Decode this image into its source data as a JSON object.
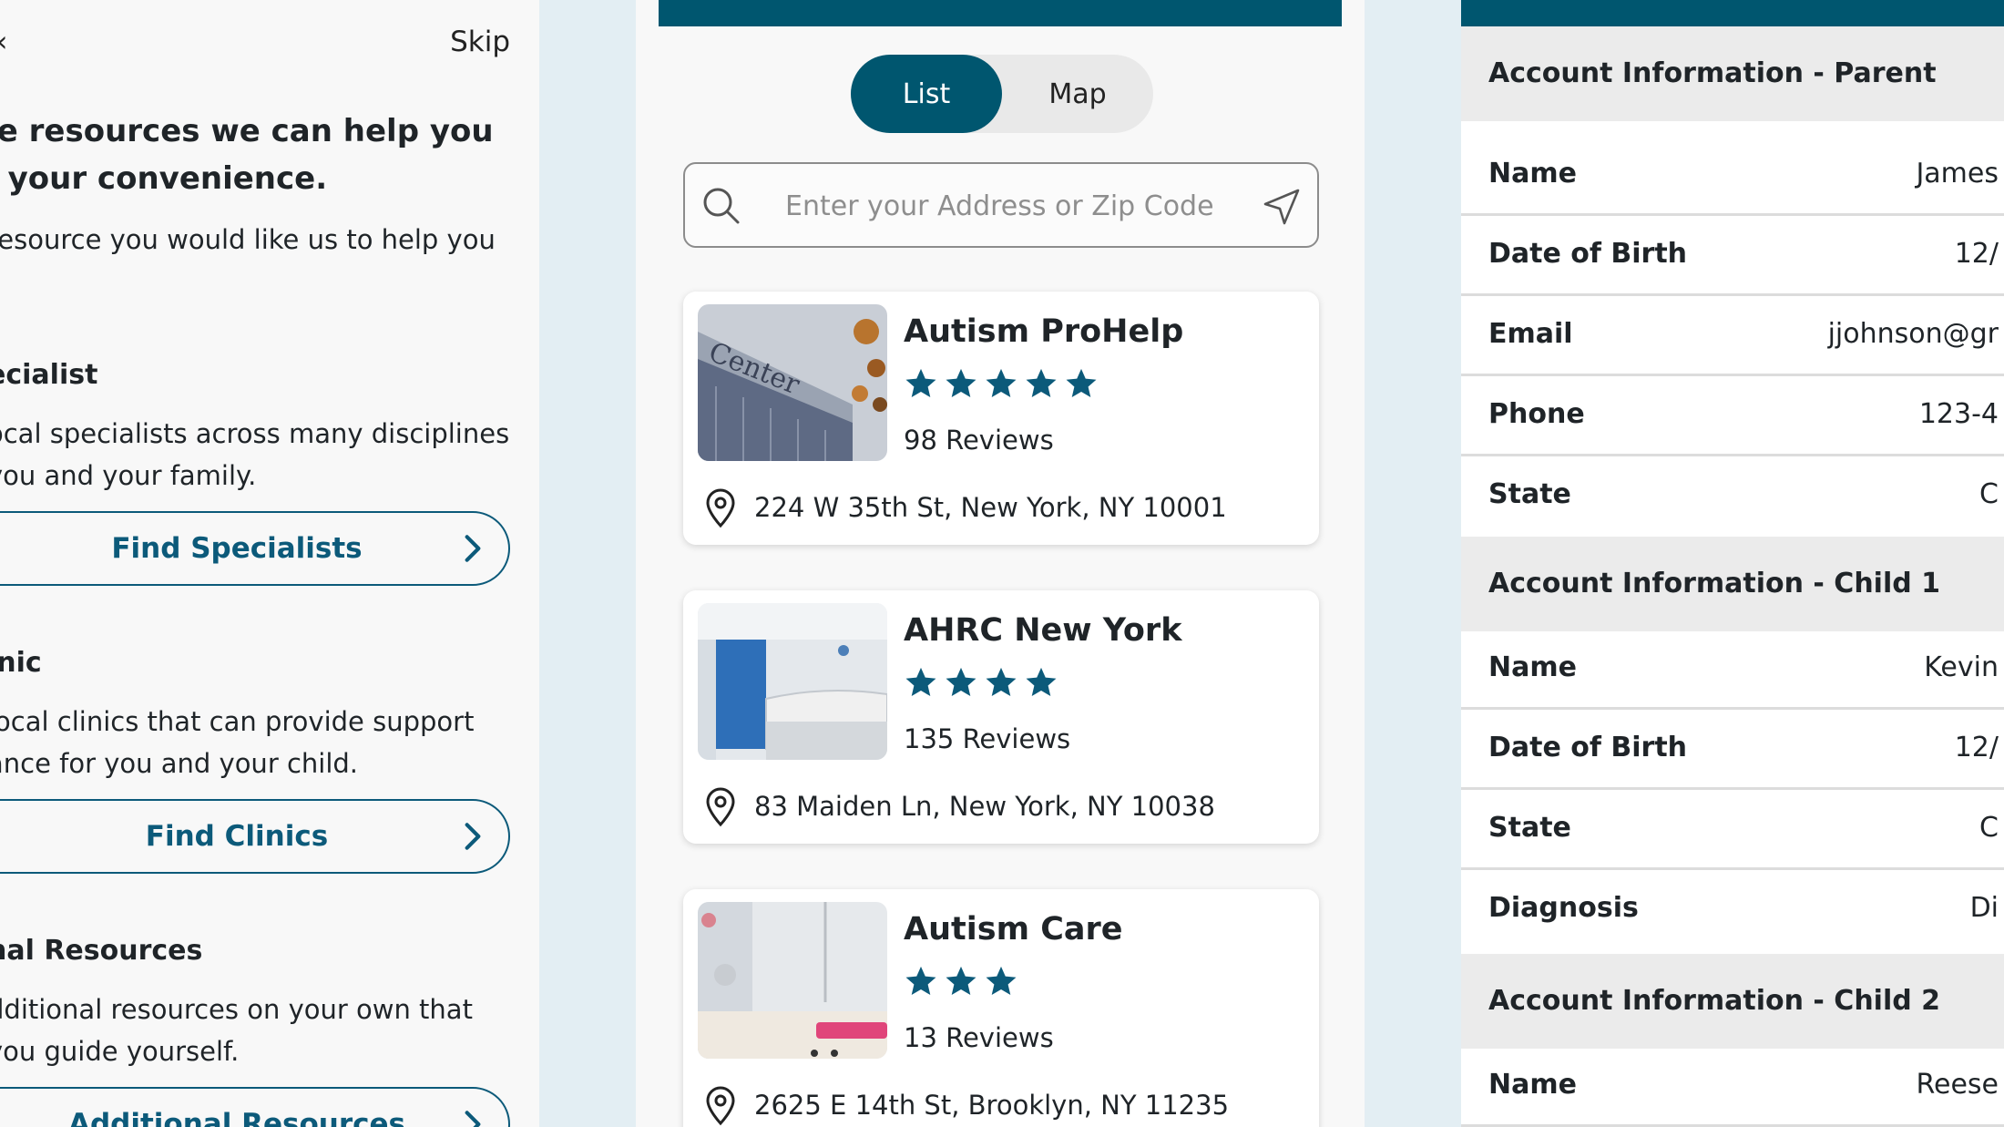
{
  "left": {
    "back_label": "‹",
    "skip_label": "Skip",
    "heading_line1": "re resources we can help you",
    "heading_line2": "r your convenience.",
    "intro": "resource you would like us to help you",
    "sections": [
      {
        "title": "ecialist",
        "desc_line1": "ocal specialists across many disciplines",
        "desc_line2": "you and your family.",
        "button": "Find Specialists"
      },
      {
        "title": "inic",
        "desc_line1": "local clinics that can provide support",
        "desc_line2": "ance for you and your child.",
        "button": "Find Clinics"
      },
      {
        "title": "nal Resources",
        "desc_line1": "dditional resources on your own that",
        "desc_line2": "you guide yourself.",
        "button": "Additional Resources"
      }
    ]
  },
  "middle": {
    "toggle": {
      "list": "List",
      "map": "Map"
    },
    "search": {
      "placeholder": "Enter your Address or Zip Code"
    },
    "colors": {
      "brand": "#00566f",
      "star": "#0c5a7a"
    },
    "results": [
      {
        "name": "Autism ProHelp",
        "stars": 5,
        "reviews": "98 Reviews",
        "address": "224 W 35th St, New York, NY 10001"
      },
      {
        "name": "AHRC New York",
        "stars": 4,
        "reviews": "135 Reviews",
        "address": "83 Maiden Ln, New York, NY 10038"
      },
      {
        "name": "Autism Care",
        "stars": 3,
        "reviews": "13 Reviews",
        "address": "2625 E 14th St, Brooklyn, NY 11235"
      }
    ]
  },
  "right": {
    "parent": {
      "title": "Account Information - Parent",
      "rows": [
        {
          "label": "Name",
          "value": "James"
        },
        {
          "label": "Date of Birth",
          "value": "12/"
        },
        {
          "label": "Email",
          "value": "jjohnson@gr"
        },
        {
          "label": "Phone",
          "value": "123-4"
        },
        {
          "label": "State",
          "value": "C"
        }
      ]
    },
    "child1": {
      "title": "Account Information - Child 1",
      "rows": [
        {
          "label": "Name",
          "value": "Kevin"
        },
        {
          "label": "Date of Birth",
          "value": "12/"
        },
        {
          "label": "State",
          "value": "C"
        },
        {
          "label": "Diagnosis",
          "value": "Di"
        }
      ]
    },
    "child2": {
      "title": "Account Information - Child 2",
      "rows": [
        {
          "label": "Name",
          "value": "Reese"
        }
      ]
    }
  }
}
